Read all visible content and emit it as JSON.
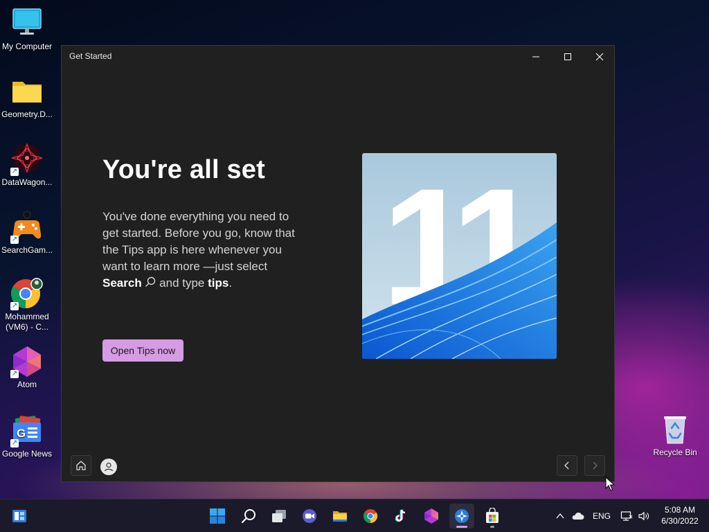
{
  "desktop": {
    "icons": [
      {
        "label": "My Computer",
        "icon": "monitor-icon"
      },
      {
        "label": "Geometry.D...",
        "icon": "folder-icon"
      },
      {
        "label": "DataWagon...",
        "icon": "datawagon-icon"
      },
      {
        "label": "SearchGam...",
        "icon": "gamepad-icon"
      },
      {
        "label": "Mohammed\n(VM6) - C...",
        "line1": "Mohammed",
        "line2": "(VM6) - C...",
        "icon": "chrome-profile-icon"
      },
      {
        "label": "Atom",
        "icon": "atom-icon"
      },
      {
        "label": "Google News",
        "icon": "google-news-icon"
      },
      {
        "label": "Recycle Bin",
        "icon": "recycle-bin-icon"
      }
    ]
  },
  "window": {
    "title": "Get Started",
    "controls": {
      "minimize": "minimize-icon",
      "maximize": "maximize-icon",
      "close": "close-icon"
    },
    "heading": "You're all set",
    "body": {
      "part1": "You've done everything you need to get started. Before you go, know that the Tips app is here whenever you want to learn more —just select ",
      "search_word": "Search",
      "part2": " and type ",
      "tips_word": "tips",
      "part3": "."
    },
    "hero_text": "11",
    "open_button": "Open Tips now",
    "footer": {
      "home": "home-icon",
      "account": "person-icon",
      "back": "chevron-left-icon",
      "next": "chevron-right-icon"
    }
  },
  "taskbar": {
    "apps": [
      "start-icon",
      "search-icon",
      "task-view-icon",
      "chat-icon",
      "file-explorer-icon",
      "chrome-icon",
      "tiktok-icon",
      "atom-icon",
      "get-started-icon",
      "microsoft-store-icon"
    ],
    "tray": {
      "language": "ENG",
      "time": "5:08 AM",
      "date": "6/30/2022"
    }
  },
  "colors": {
    "accent_button": "#d59be3",
    "window_bg": "#202020",
    "taskbar_bg": "#1b1a2a"
  }
}
